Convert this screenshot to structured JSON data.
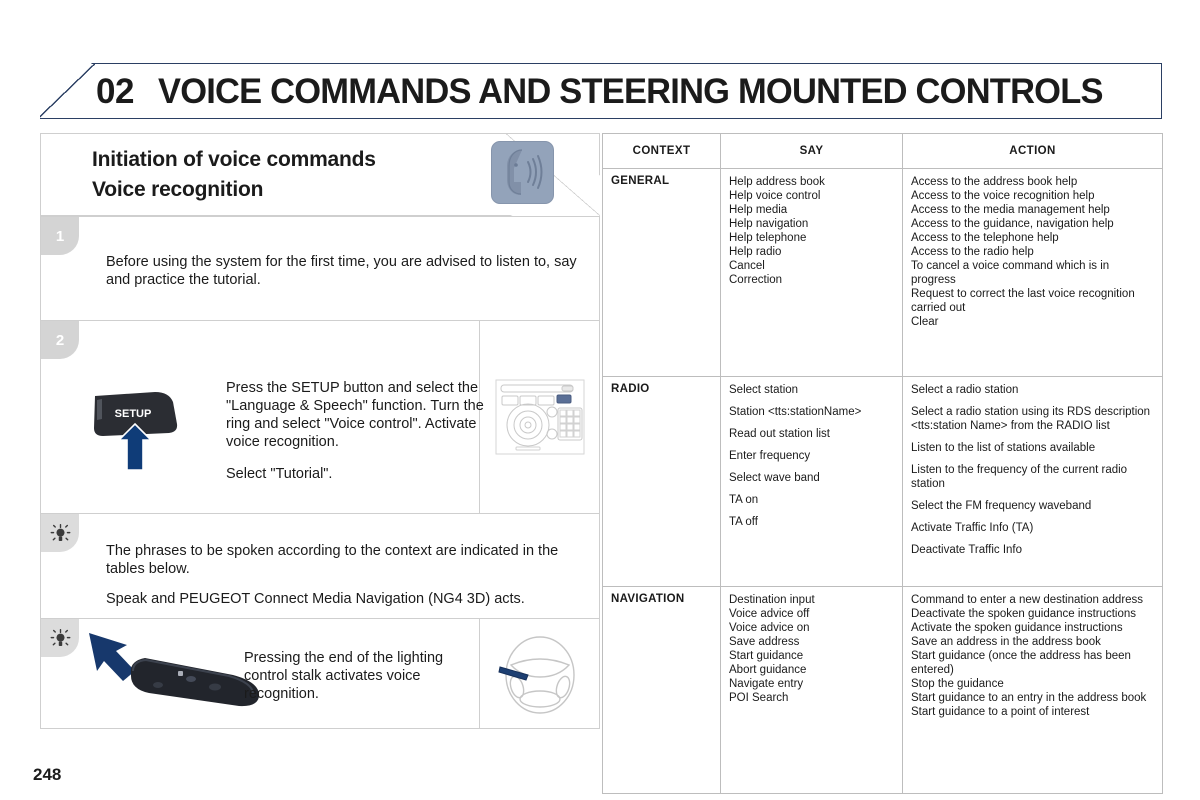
{
  "header": {
    "chapter_number": "02",
    "chapter_title": "VOICE COMMANDS AND STEERING MOUNTED CONTROLS"
  },
  "left": {
    "title_line1": "Initiation of voice commands",
    "title_line2": "Voice recognition",
    "voice_icon_name": "voice-recognition-icon",
    "steps": [
      {
        "badge": "1",
        "text": "Before using the system for the first time, you are advised to listen to, say and practice the tutorial."
      },
      {
        "badge": "2",
        "text_block1": "Press the SETUP button and select the \"Language & Speech\" function. Turn the ring and select \"Voice control\". Activate voice recognition.",
        "text_block2": "Select \"Tutorial\".",
        "setup_button_label": "SETUP",
        "side_figure_name": "radio-head-unit-illustration"
      }
    ],
    "tips": [
      {
        "text_block1": "The phrases to be spoken according to the context are indicated in the tables below.",
        "text_block2": "Speak and PEUGEOT Connect Media Navigation (NG4 3D) acts."
      },
      {
        "text": "Pressing the end of the lighting control stalk activates voice recognition.",
        "side_figure_name": "steering-wheel-illustration",
        "main_figure_name": "lighting-control-stalk-illustration"
      }
    ]
  },
  "table": {
    "headers": [
      "CONTEXT",
      "SAY",
      "ACTION"
    ],
    "rows": [
      {
        "context": "GENERAL",
        "say": [
          "Help address book",
          "Help voice control",
          "Help media",
          "Help navigation",
          "Help telephone",
          "Help radio",
          "Cancel",
          "Correction"
        ],
        "action": [
          "Access to the address book help",
          "Access to the voice recognition help",
          "Access to the media management help",
          "Access to the guidance, navigation help",
          "Access to the telephone help",
          "Access to the radio help",
          "To cancel a voice command which is in progress",
          "Request to correct the last voice recognition carried out",
          "Clear"
        ],
        "spacing": "tight"
      },
      {
        "context": "RADIO",
        "say": [
          "Select station",
          "Station <tts:stationName>",
          "Read out station list",
          "Enter frequency",
          "Select wave band",
          "TA on",
          "TA off"
        ],
        "action": [
          "Select a radio station",
          "Select a radio station using its RDS description <tts:station Name> from the RADIO list",
          "Listen to the list of stations available",
          "Listen to the frequency of the current radio station",
          "Select the FM frequency waveband",
          "Activate Traffic Info (TA)",
          "Deactivate Traffic Info"
        ],
        "spacing": "loose"
      },
      {
        "context": "NAVIGATION",
        "say": [
          "Destination input",
          "Voice advice off",
          "Voice advice on",
          "Save address",
          "Start guidance",
          "Abort guidance",
          "Navigate entry",
          "POI Search"
        ],
        "action": [
          "Command to enter a new destination address",
          "Deactivate the spoken guidance instructions",
          "Activate the spoken guidance instructions",
          "Save an address in the address book",
          "Start guidance (once the address has been entered)",
          "Stop the guidance",
          "Start guidance to an entry in the address book",
          "Start guidance to a point of interest"
        ],
        "spacing": "tight-action-loose"
      }
    ]
  },
  "footer": {
    "page_number": "248"
  },
  "colors": {
    "banner_border": "#2b3f63",
    "panel_border": "#cfcfcf",
    "table_border": "#bdbdbd",
    "badge_grey": "#d4d4d4",
    "icon_blue_grey": "#93a3ba",
    "arrow_navy": "#123a6b"
  }
}
